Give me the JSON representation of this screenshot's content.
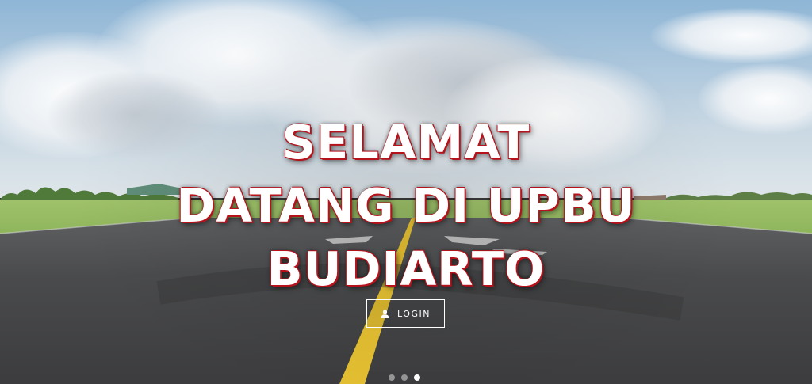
{
  "hero": {
    "headline_lines": [
      "SELAMAT",
      "DATANG DI UPBU",
      "BUDIARTO"
    ],
    "login_label": "LOGIN",
    "login_icon": "user-icon"
  },
  "carousel": {
    "slide_count": 3,
    "active_index": 2
  },
  "colors": {
    "headline_text": "#ffffff",
    "headline_outline": "#b5121b",
    "button_border": "#ffffff",
    "runway_center_line": "#e5c032"
  }
}
